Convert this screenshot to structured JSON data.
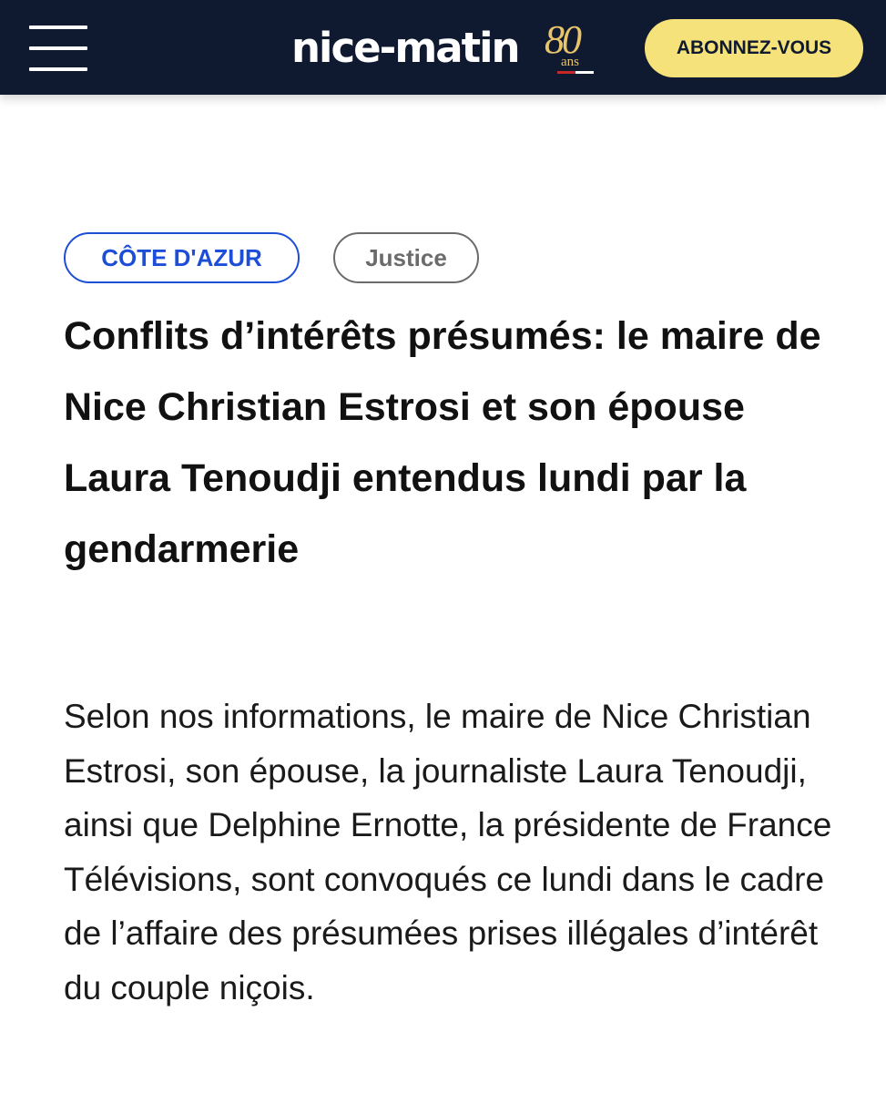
{
  "header": {
    "menu_icon": "hamburger-menu-icon",
    "logo": {
      "text": "nice-matin",
      "anniversary_number": "80",
      "anniversary_unit": "ans"
    },
    "subscribe_label": "ABONNEZ-VOUS",
    "colors": {
      "background": "#0f1a30",
      "subscribe_bg": "#f6e27a",
      "anniversary": "#e9c46a"
    }
  },
  "article": {
    "region_tag": "CÔTE D'AZUR",
    "section_tag": "Justice",
    "headline": "Conflits d’intérêts présumés: le maire de Nice Christian Estrosi et son épouse Laura Tenoudji entendus lundi par la gendarmerie",
    "lead": "Selon nos informations, le maire de Nice Christian Estrosi, son épouse, la journaliste Laura Tenoudji, ainsi que Delphine Ernotte, la présidente de France Télévisions, sont convoqués ce lundi dans le cadre de l’affaire des présumées prises illégales d’intérêt du couple niçois.",
    "colors": {
      "region_tag": "#1d4ed8",
      "section_tag": "#6b6b6b"
    }
  }
}
